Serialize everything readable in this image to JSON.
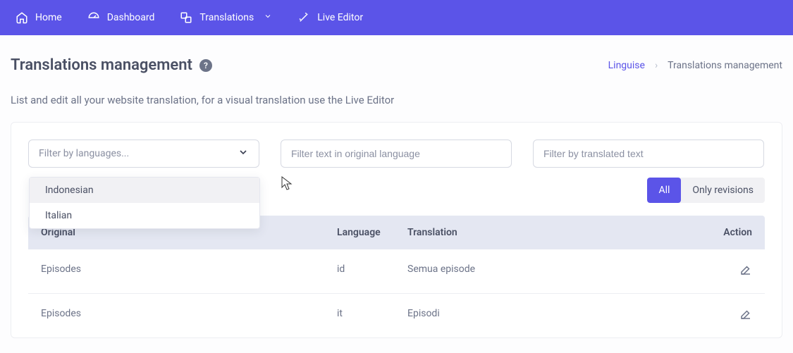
{
  "nav": {
    "home": "Home",
    "dashboard": "Dashboard",
    "translations": "Translations",
    "live_editor": "Live Editor"
  },
  "page": {
    "title": "Translations management",
    "subtitle": "List and edit all your website translation, for a visual translation use the Live Editor"
  },
  "breadcrumb": {
    "root": "Linguise",
    "current": "Translations management"
  },
  "filters": {
    "language_select_placeholder": "Filter by languages...",
    "original_text_placeholder": "Filter text in original language",
    "translated_text_placeholder": "Filter by translated text",
    "dropdown": [
      "Indonesian",
      "Italian"
    ]
  },
  "segmented": {
    "all": "All",
    "only_revisions": "Only revisions"
  },
  "table": {
    "headers": {
      "original": "Original",
      "language": "Language",
      "translation": "Translation",
      "action": "Action"
    },
    "rows": [
      {
        "original": "Episodes",
        "language": "id",
        "translation": "Semua episode"
      },
      {
        "original": "Episodes",
        "language": "it",
        "translation": "Episodi"
      }
    ]
  }
}
